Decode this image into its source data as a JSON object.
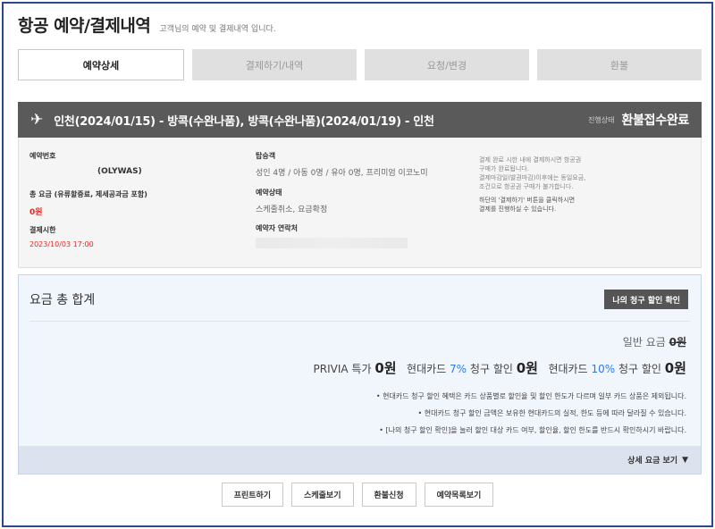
{
  "header": {
    "title": "항공 예약/결제내역",
    "subtitle": "고객님의 예약 및 결제내역 입니다."
  },
  "tabs": [
    {
      "label": "예약상세",
      "active": true
    },
    {
      "label": "결제하기/내역",
      "active": false
    },
    {
      "label": "요청/변경",
      "active": false
    },
    {
      "label": "환불",
      "active": false
    }
  ],
  "route": {
    "icon": "airplane-icon",
    "text": "인천(2024/01/15) - 방콕(수완나품), 방콕(수완나품)(2024/01/19) - 인천",
    "status_label": "진행상태",
    "status_value": "환불접수완료"
  },
  "booking": {
    "reservation_no_label": "예약번호",
    "reservation_no_value": "(OLYWAS)",
    "total_fare_label": "총 요금 (유류할증료, 제세공과금 포함)",
    "total_fare_value": "0원",
    "payment_deadline_label": "결제시한",
    "payment_deadline_value": "2023/10/03 17:00",
    "passengers_label": "탑승객",
    "passengers_value": "성인 4명 / 아동 0명 / 유아 0명, 프리미엄 이코노미",
    "booking_status_label": "예약상태",
    "booking_status_value": "스케줄취소, 요금확정",
    "contact_label": "예약자 연락처",
    "notes_1": [
      "결제 완료 시한 내에 결제하시면 항공권",
      "구매가 완료됩니다.",
      "결제마감일(발권마감)이후에는 동일요금,",
      "조건으로 항공권 구매가 불가합니다."
    ],
    "notes_2": [
      "하단의 '결제하기' 버튼을 클릭하시면",
      "결제를 진행하실 수 있습니다."
    ]
  },
  "fare": {
    "title": "요금 총 합계",
    "my_discount_button": "나의 청구 할인 확인",
    "base_fare_label": "일반 요금",
    "base_fare_value": "0원",
    "prima_label": "PRIVIA 특가",
    "prima_value": "0원",
    "hyundai7_prefix": "현대카드",
    "hyundai7_pct": "7%",
    "hyundai7_suffix": "청구 할인",
    "hyundai7_value": "0원",
    "hyundai10_prefix": "현대카드",
    "hyundai10_pct": "10%",
    "hyundai10_suffix": "청구 할인",
    "hyundai10_value": "0원",
    "notices": [
      "• 현대카드 청구 할인 혜택은 카드 상품별로 할인율 및 할인 한도가 다르며 일부 카드 상품은 제외됩니다.",
      "• 현대카드 청구 할인 금액은 보유한 현대카드의 실적, 한도 등에 따라 달라질 수 있습니다.",
      "• [나의 청구 할인 확인]을 눌러 할인 대상 카드 여부, 할인율, 할인 한도를 반드시 확인하시기 바랍니다."
    ],
    "detail_toggle": "상세 요금 보기"
  },
  "actions": [
    {
      "name": "print-button",
      "label": "프린트하기"
    },
    {
      "name": "schedule-button",
      "label": "스케줄보기"
    },
    {
      "name": "refund-request-button",
      "label": "환불신청"
    },
    {
      "name": "booking-list-button",
      "label": "예약목록보기"
    }
  ]
}
